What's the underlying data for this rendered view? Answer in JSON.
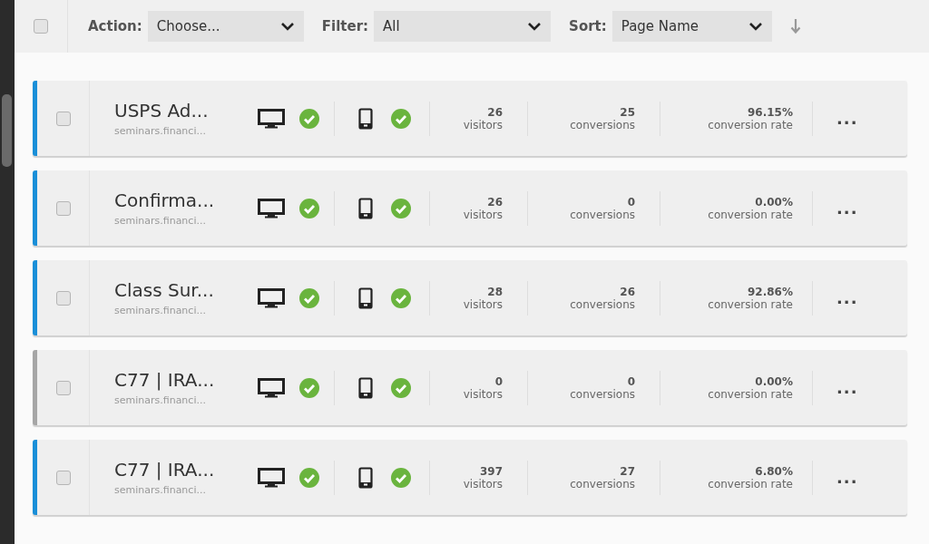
{
  "toolbar": {
    "select_all": {
      "checked": false
    },
    "action": {
      "label": "Action:",
      "value": "Choose..."
    },
    "filter": {
      "label": "Filter:",
      "value": "All"
    },
    "sort": {
      "label": "Sort:",
      "value": "Page Name"
    }
  },
  "pages": [
    {
      "name": "USPS Ad...",
      "url": "seminars.financi...",
      "color": "#1a8fd8",
      "checked": false,
      "desktop_ok": true,
      "mobile_ok": true,
      "visitors": "26",
      "visitors_label": "visitors",
      "conversions": "25",
      "conversions_label": "conversions",
      "rate": "96.15%",
      "rate_label": "conversion rate",
      "more": "..."
    },
    {
      "name": "Confirma...",
      "url": "seminars.financi...",
      "color": "#1a8fd8",
      "checked": false,
      "desktop_ok": true,
      "mobile_ok": true,
      "visitors": "26",
      "visitors_label": "visitors",
      "conversions": "0",
      "conversions_label": "conversions",
      "rate": "0.00%",
      "rate_label": "conversion rate",
      "more": "..."
    },
    {
      "name": "Class Sur...",
      "url": "seminars.financi...",
      "color": "#1a8fd8",
      "checked": false,
      "desktop_ok": true,
      "mobile_ok": true,
      "visitors": "28",
      "visitors_label": "visitors",
      "conversions": "26",
      "conversions_label": "conversions",
      "rate": "92.86%",
      "rate_label": "conversion rate",
      "more": "..."
    },
    {
      "name": "C77 | IRA...",
      "url": "seminars.financi...",
      "color": "#a6a6a6",
      "checked": false,
      "desktop_ok": true,
      "mobile_ok": true,
      "visitors": "0",
      "visitors_label": "visitors",
      "conversions": "0",
      "conversions_label": "conversions",
      "rate": "0.00%",
      "rate_label": "conversion rate",
      "more": "..."
    },
    {
      "name": "C77 | IRA...",
      "url": "seminars.financi...",
      "color": "#1a8fd8",
      "checked": false,
      "desktop_ok": true,
      "mobile_ok": true,
      "visitors": "397",
      "visitors_label": "visitors",
      "conversions": "27",
      "conversions_label": "conversions",
      "rate": "6.80%",
      "rate_label": "conversion rate",
      "more": "..."
    }
  ]
}
